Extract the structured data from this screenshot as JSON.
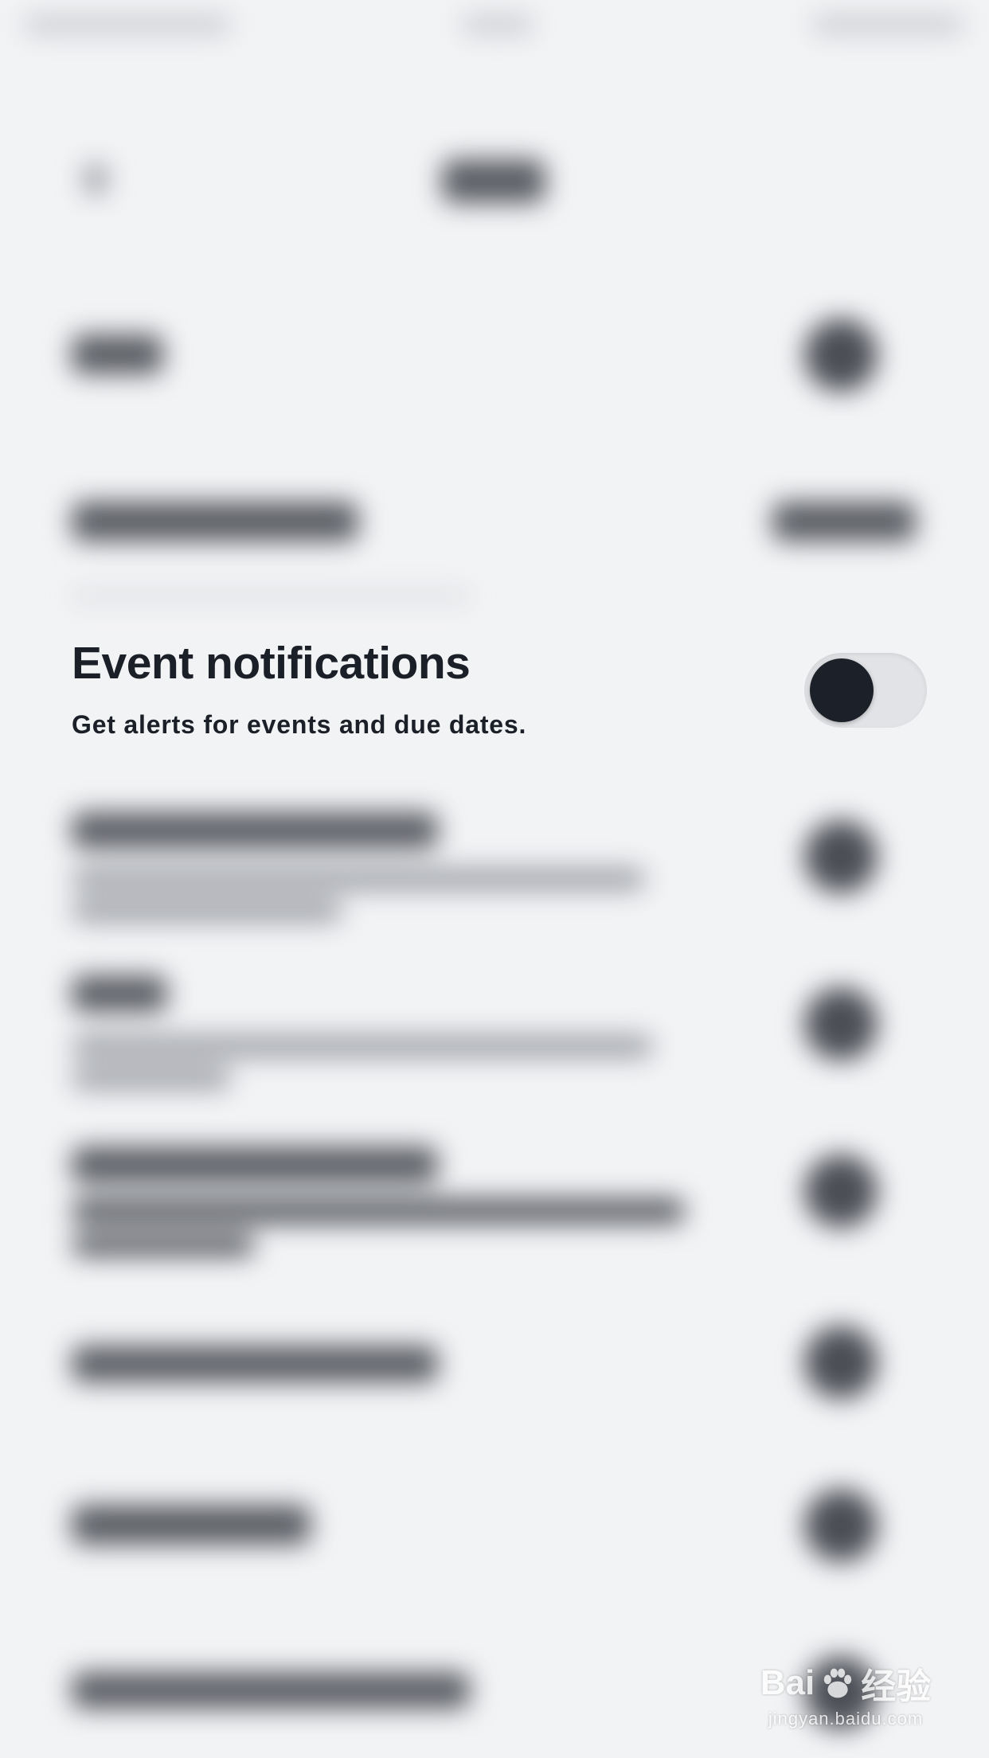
{
  "focused_setting": {
    "title": "Event notifications",
    "subtitle": "Get alerts for events and due dates.",
    "toggle_on": false
  },
  "watermark": {
    "logo_text": "Bai",
    "logo_suffix": "经验",
    "url": "jingyan.baidu.com"
  },
  "colors": {
    "background": "#f2f3f5",
    "text": "#1b1f27",
    "toggle_track": "#e2e3e6",
    "toggle_knob": "#1b2029"
  }
}
